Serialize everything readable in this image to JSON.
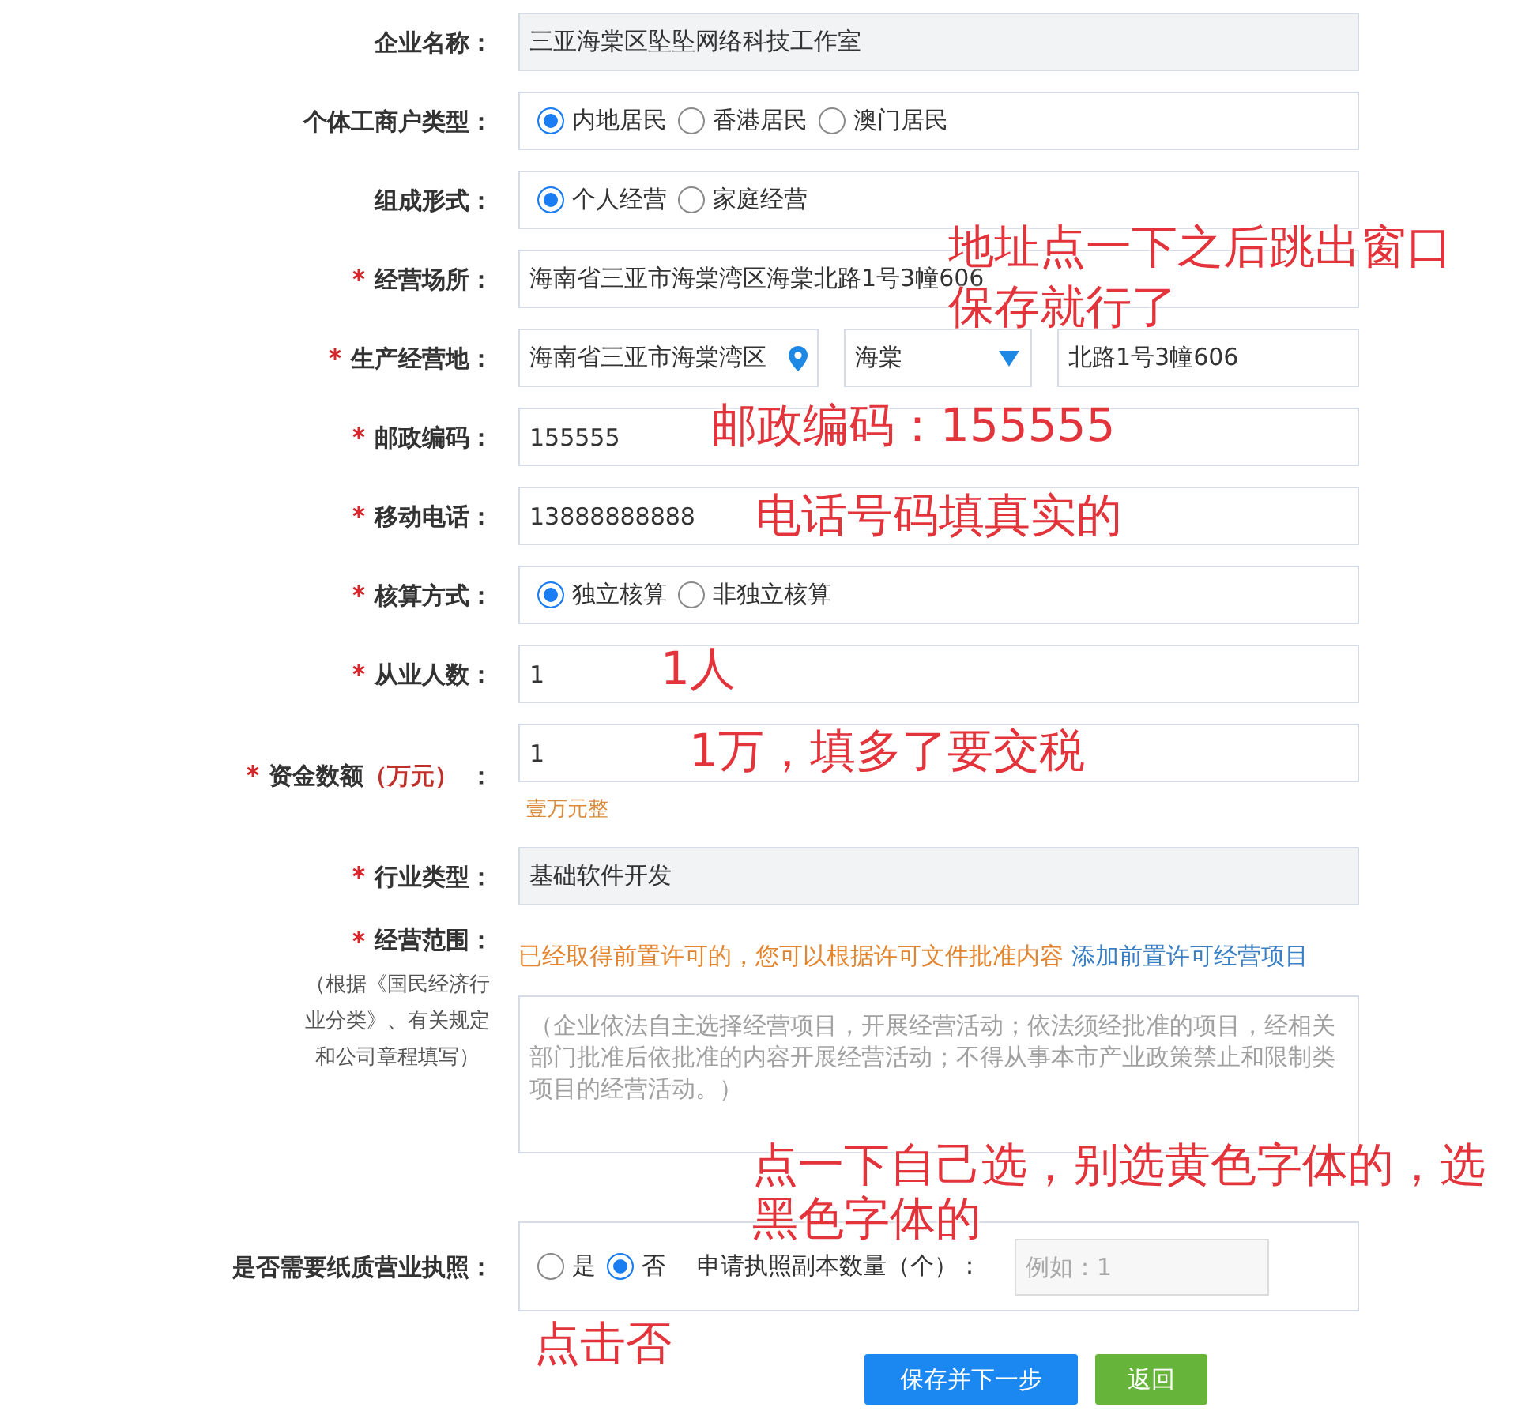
{
  "form": {
    "rows": [
      {
        "kind": "readonly",
        "label": "企业名称：",
        "required": false,
        "value": "三亚海棠区坠坠网络科技工作室"
      },
      {
        "kind": "radio",
        "label": "个体工商户类型：",
        "required": false,
        "options": [
          {
            "label": "内地居民",
            "selected": true
          },
          {
            "label": "香港居民",
            "selected": false
          },
          {
            "label": "澳门居民",
            "selected": false
          }
        ]
      },
      {
        "kind": "radio",
        "label": "组成形式：",
        "required": false,
        "options": [
          {
            "label": "个人经营",
            "selected": true
          },
          {
            "label": "家庭经营",
            "selected": false
          }
        ]
      },
      {
        "kind": "text",
        "label": "经营场所：",
        "required": true,
        "value": "海南省三亚市海棠湾区海棠北路1号3幢606",
        "annotation": [
          "地址点一下之后跳出窗口",
          "保存就行了"
        ]
      },
      {
        "kind": "address",
        "label": "生产经营地：",
        "required": true,
        "district": "海南省三亚市海棠湾区",
        "town": "海棠",
        "street": "北路1号3幢606"
      },
      {
        "kind": "text",
        "label": "邮政编码：",
        "required": true,
        "value": "155555",
        "annotation": [
          "邮政编码：155555"
        ]
      },
      {
        "kind": "text",
        "label": "移动电话：",
        "required": true,
        "value": "13888888888",
        "annotation": [
          "电话号码填真实的"
        ]
      },
      {
        "kind": "radio",
        "label": "核算方式：",
        "required": true,
        "options": [
          {
            "label": "独立核算",
            "selected": true
          },
          {
            "label": "非独立核算",
            "selected": false
          }
        ]
      },
      {
        "kind": "text",
        "label": "从业人数：",
        "required": true,
        "value": "1",
        "annotation": [
          "1人"
        ]
      },
      {
        "kind": "text",
        "label": "资金数额",
        "label_unit": "（万元）",
        "label_suffix": "：",
        "required": true,
        "value": "1",
        "hint": "壹万元整",
        "annotation": [
          "1万，填多了要交税"
        ]
      },
      {
        "kind": "readonly",
        "label": "行业类型：",
        "required": true,
        "value": "基础软件开发"
      },
      {
        "kind": "scope",
        "label": "经营范围：",
        "required": true,
        "label_note": "（根据《国民经济行业分类》、有关规定和公司章程填写）",
        "notice": "已经取得前置许可的，您可以根据许可文件批准内容",
        "link": "添加前置许可经营项目",
        "placeholder": "（企业依法自主选择经营项目，开展经营活动；依法须经批准的项目，经相关部门批准后依批准的内容开展经营活动；不得从事本市产业政策禁止和限制类项目的经营活动。）",
        "annotation": [
          "点一下自己选，别选黄色字体的，选",
          "黑色字体的"
        ]
      },
      {
        "kind": "license",
        "label": "是否需要纸质营业执照：",
        "required": false,
        "options": [
          {
            "label": "是",
            "selected": false
          },
          {
            "label": "否",
            "selected": true
          }
        ],
        "copies_label": "申请执照副本数量（个）：",
        "copies_placeholder": "例如：1",
        "annotation": [
          "点击否"
        ]
      }
    ]
  },
  "buttons": [
    {
      "kind": "primary",
      "label": "保存并下一步"
    },
    {
      "kind": "success",
      "label": "返回"
    }
  ]
}
